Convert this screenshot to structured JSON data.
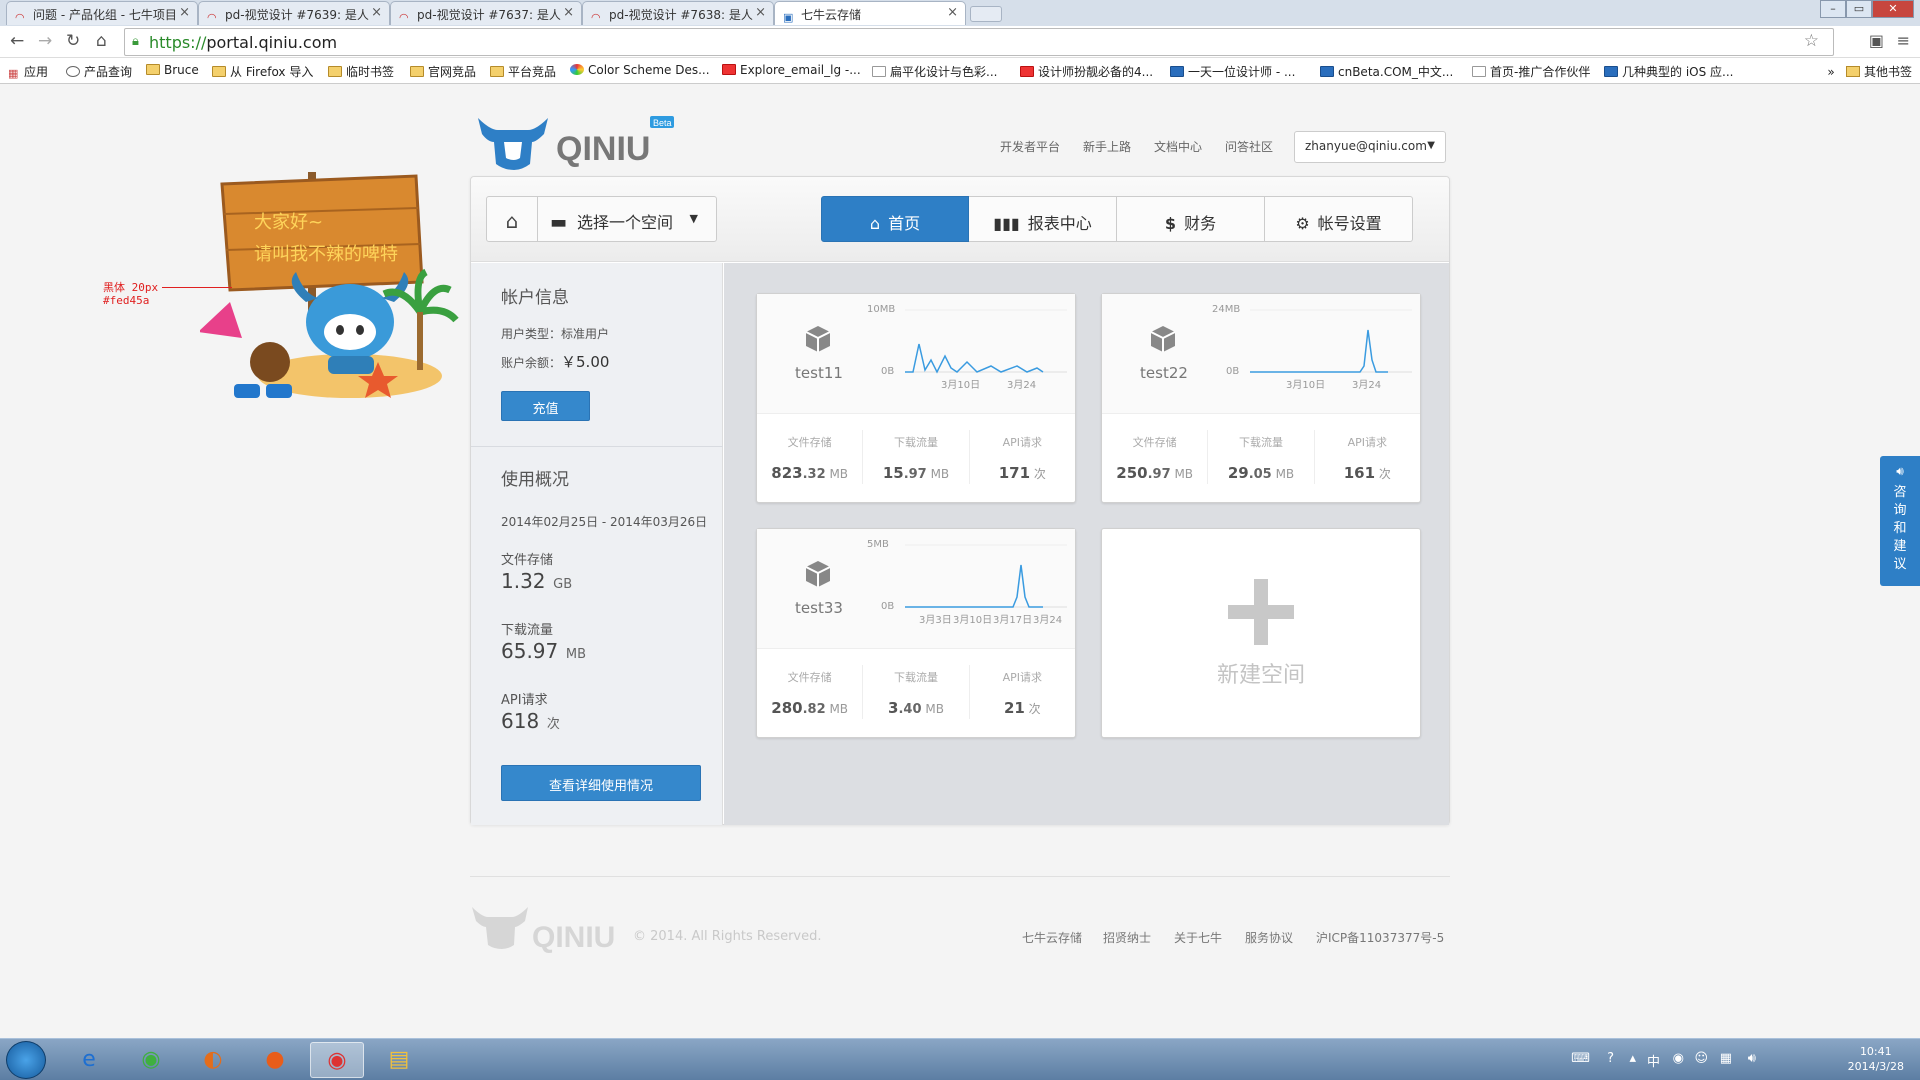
{
  "browser": {
    "tabs": [
      {
        "title": "问题 - 产品化组 - 七牛项目",
        "active": false
      },
      {
        "title": "pd-视觉设计 #7639: 是人",
        "active": false
      },
      {
        "title": "pd-视觉设计 #7637: 是人",
        "active": false
      },
      {
        "title": "pd-视觉设计 #7638: 是人",
        "active": false
      },
      {
        "title": "七牛云存储",
        "active": true
      }
    ],
    "url_scheme": "https://",
    "url_host": "portal.qiniu.com",
    "bookmarks": [
      "应用",
      "产品查询",
      "Bruce",
      "从 Firefox 导入",
      "临时书签",
      "官网竞品",
      "平台竞品",
      "Color Scheme Des...",
      "Explore_email_lg -...",
      "扁平化设计与色彩...",
      "设计师扮靓必备的4...",
      "一天一位设计师 - ...",
      "cnBeta.COM_中文...",
      "首页-推广合作伙伴",
      "几种典型的 iOS 应...",
      "其他书签"
    ],
    "overflow": "»"
  },
  "mascot": {
    "sign_line1": "大家好~",
    "sign_line2": "请叫我不辣的啤特",
    "annotation_line1": "黑体 20px",
    "annotation_line2": "#fed45a"
  },
  "header": {
    "logo_text": "QINIU",
    "logo_badge": "Beta",
    "links": [
      "开发者平台",
      "新手上路",
      "文档中心",
      "问答社区"
    ],
    "account_email": "zhanyue@qiniu.com"
  },
  "toolbar": {
    "space_select": "选择一个空间",
    "tabs": [
      "首页",
      "报表中心",
      "财务",
      "帐号设置"
    ]
  },
  "sidebar": {
    "account_title": "帐户信息",
    "user_type_label": "用户类型：",
    "user_type_value": "标准用户",
    "balance_label": "账户余额：",
    "balance_value": "￥5.00",
    "recharge_button": "充值",
    "usage_title": "使用概况",
    "date_range": "2014年02月25日 - 2014年03月26日",
    "storage_label": "文件存储",
    "storage_value": "1.32",
    "storage_unit": "GB",
    "download_label": "下载流量",
    "download_value": "65.97",
    "download_unit": "MB",
    "api_label": "API请求",
    "api_value": "618",
    "api_unit": "次",
    "detail_button": "查看详细使用情况"
  },
  "stat_labels": {
    "storage": "文件存储",
    "download": "下载流量",
    "api": "API请求"
  },
  "spaces": [
    {
      "name": "test11",
      "ymax": "10MB",
      "ymin": "0B",
      "x_labels": [
        "3月10日",
        "3月24"
      ],
      "storage_int": "823",
      "storage_dec": ".32",
      "storage_unit": "MB",
      "download_int": "15",
      "download_dec": ".97",
      "download_unit": "MB",
      "api": "171",
      "api_unit": "次"
    },
    {
      "name": "test22",
      "ymax": "24MB",
      "ymin": "0B",
      "x_labels": [
        "3月10日",
        "3月24"
      ],
      "storage_int": "250",
      "storage_dec": ".97",
      "storage_unit": "MB",
      "download_int": "29",
      "download_dec": ".05",
      "download_unit": "MB",
      "api": "161",
      "api_unit": "次"
    },
    {
      "name": "test33",
      "ymax": "5MB",
      "ymin": "0B",
      "x_labels": [
        "3月3日",
        "3月10日",
        "3月17日",
        "3月24"
      ],
      "storage_int": "280",
      "storage_dec": ".82",
      "storage_unit": "MB",
      "download_int": "3",
      "download_dec": ".40",
      "download_unit": "MB",
      "api": "21",
      "api_unit": "次"
    }
  ],
  "new_space": {
    "label": "新建空间"
  },
  "footer": {
    "logo_text": "QINIU",
    "copyright": "© 2014. All Rights Reserved.",
    "links": [
      "七牛云存储",
      "招贤纳士",
      "关于七牛",
      "服务协议",
      "沪ICP备11037377号-5"
    ]
  },
  "feedback": {
    "label": "咨询和建议"
  },
  "taskbar": {
    "time": "10:41",
    "date": "2014/3/28"
  },
  "colors": {
    "accent": "#2e7fc6",
    "sparkline": "#3a9be0",
    "annotation": "#e02020",
    "sign_text": "#fed45a"
  }
}
